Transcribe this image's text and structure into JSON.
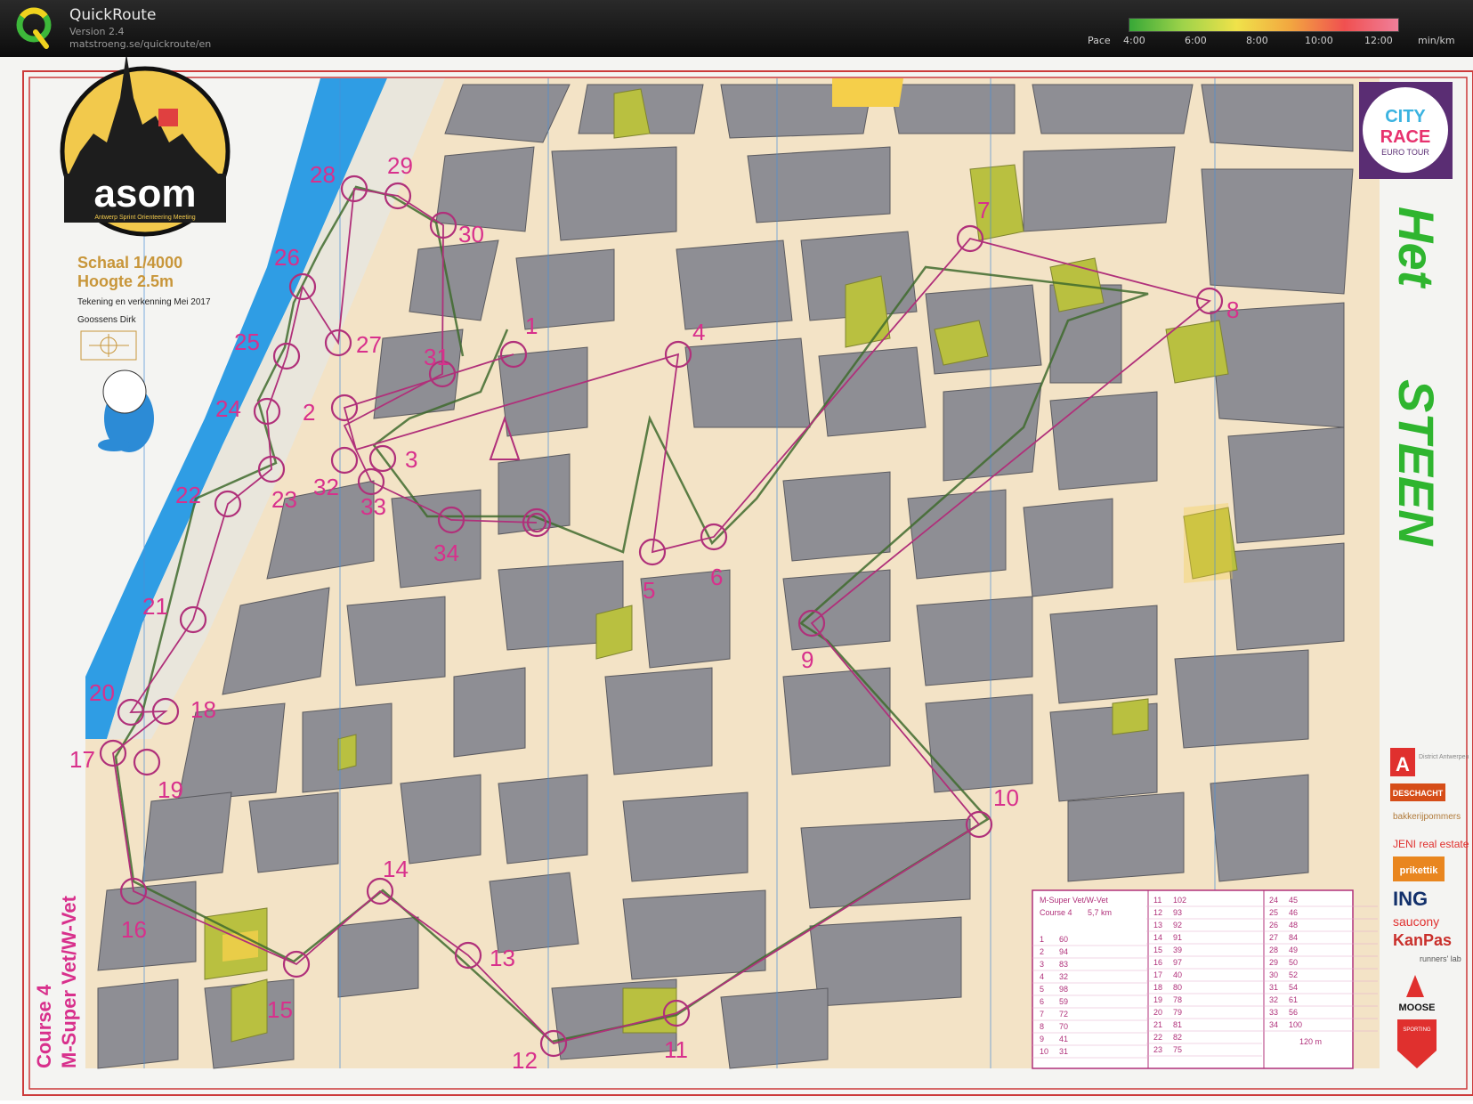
{
  "app": {
    "title": "QuickRoute",
    "version": "Version 2.4",
    "url": "matstroeng.se/quickroute/en",
    "logo_icon": "quickroute-q-logo-icon"
  },
  "pace_legend": {
    "label": "Pace",
    "ticks": [
      "4:00",
      "6:00",
      "8:00",
      "10:00",
      "12:00"
    ],
    "unit": "min/km",
    "colors": [
      "#37a837",
      "#9fd34a",
      "#f0e24a",
      "#f2a640",
      "#f05050",
      "#f07f9a"
    ]
  },
  "map": {
    "organizer_logo_text": "asom",
    "organizer_subtitle": "Antwerp Sprint Orienteering Meeting",
    "scale": "Schaal 1/4000",
    "contour": "Hoogte 2.5m",
    "drawing_note": "Tekening en verkenning Mei 2017",
    "author": "Goossens Dirk",
    "event_logo": [
      "CITY",
      "RACE",
      "EURO TOUR"
    ],
    "area_title": [
      "Het",
      "STEEN"
    ],
    "course_label": [
      "Course 4",
      "M-Super Vet/W-Vet"
    ],
    "controls": [
      "1",
      "2",
      "3",
      "4",
      "5",
      "6",
      "7",
      "8",
      "9",
      "10",
      "11",
      "12",
      "13",
      "14",
      "15",
      "16",
      "17",
      "18",
      "19",
      "20",
      "21",
      "22",
      "23",
      "24",
      "25",
      "26",
      "27",
      "28",
      "29",
      "30",
      "31",
      "32",
      "33",
      "34"
    ],
    "sponsors": [
      "District Antwerpen",
      "DESCHACHT",
      "bakkerijpommers",
      "JENI real estate",
      "prikettik",
      "ING",
      "saucony",
      "KanPas",
      "runners' lab",
      "MOOSE",
      "SPORTING"
    ],
    "description_sheet": {
      "header": "M-Super Vet/W-Vet",
      "course": "Course 4",
      "length": "5,7 km",
      "col1": [
        [
          "1",
          "60"
        ],
        [
          "2",
          "94"
        ],
        [
          "3",
          "83"
        ],
        [
          "4",
          "32"
        ],
        [
          "5",
          "98"
        ],
        [
          "6",
          "59"
        ],
        [
          "7",
          "72"
        ],
        [
          "8",
          "70"
        ],
        [
          "9",
          "41"
        ],
        [
          "10",
          "31"
        ]
      ],
      "col2": [
        [
          "11",
          "102"
        ],
        [
          "12",
          "93"
        ],
        [
          "13",
          "92"
        ],
        [
          "14",
          "91"
        ],
        [
          "15",
          "39"
        ],
        [
          "16",
          "97"
        ],
        [
          "17",
          "40"
        ],
        [
          "18",
          "80"
        ],
        [
          "19",
          "78"
        ],
        [
          "20",
          "79"
        ],
        [
          "21",
          "81"
        ],
        [
          "22",
          "82"
        ],
        [
          "23",
          "75"
        ]
      ],
      "col3": [
        [
          "24",
          "45"
        ],
        [
          "25",
          "46"
        ],
        [
          "26",
          "48"
        ],
        [
          "27",
          "84"
        ],
        [
          "28",
          "49"
        ],
        [
          "29",
          "50"
        ],
        [
          "30",
          "52"
        ],
        [
          "31",
          "54"
        ],
        [
          "32",
          "61"
        ],
        [
          "33",
          "56"
        ],
        [
          "34",
          "100"
        ]
      ],
      "finish_distance": "120 m"
    }
  }
}
